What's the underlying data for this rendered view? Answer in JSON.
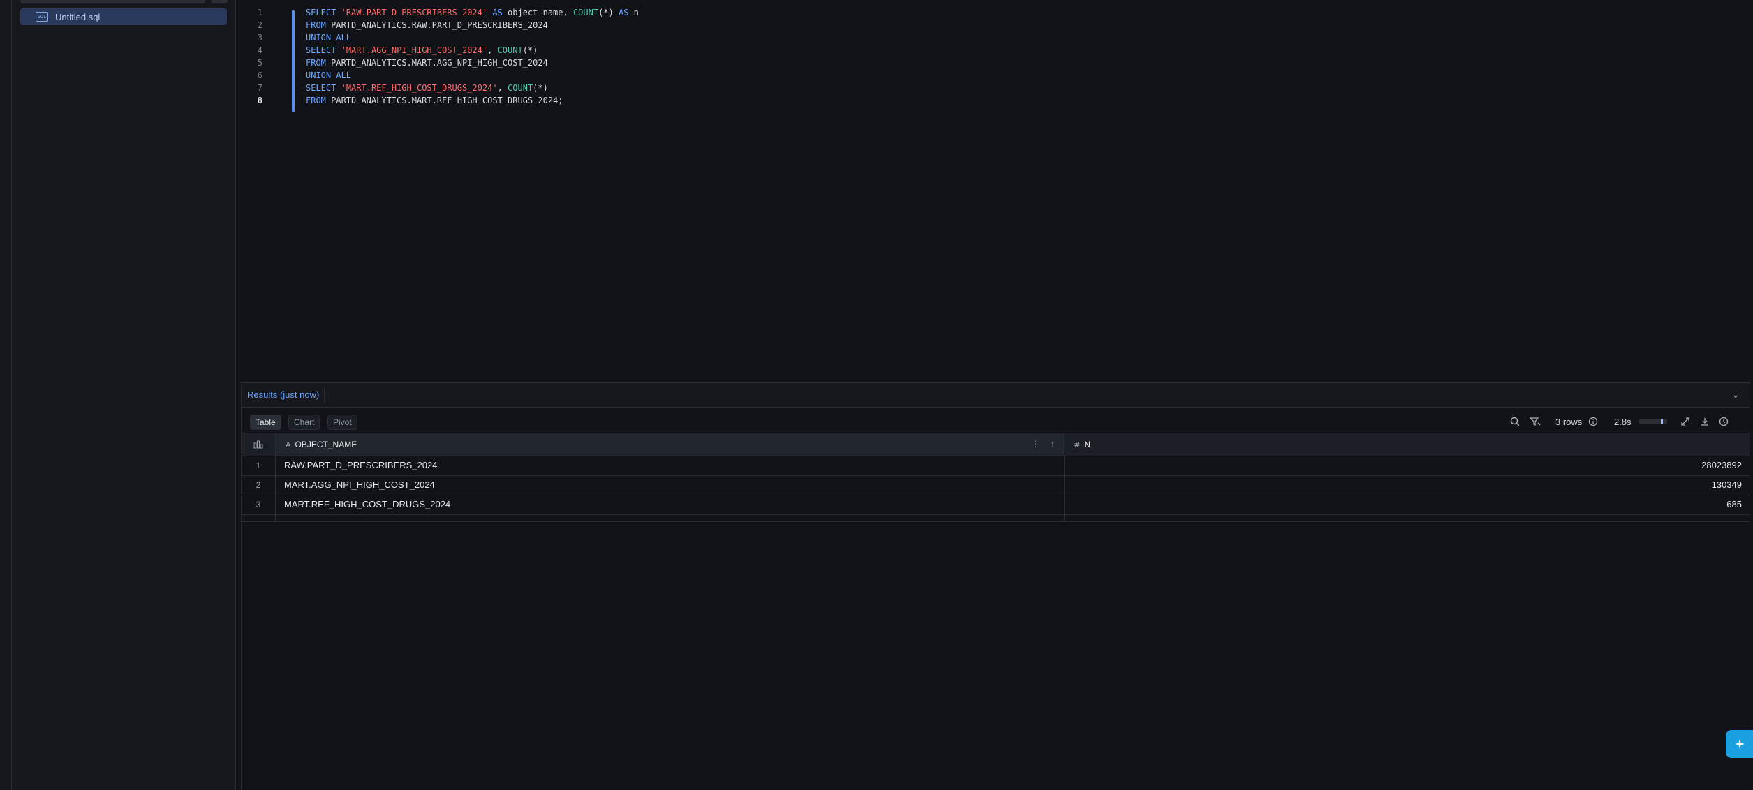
{
  "sidebar": {
    "file": {
      "label": "Untitled.sql",
      "icon": "sql-file-icon"
    }
  },
  "editor": {
    "active_line": 8,
    "lines": [
      {
        "n": "1",
        "tokens": [
          [
            "kw",
            "SELECT"
          ],
          [
            "pun",
            " "
          ],
          [
            "str",
            "'RAW.PART_D_PRESCRIBERS_2024'"
          ],
          [
            "pun",
            " "
          ],
          [
            "kw",
            "AS"
          ],
          [
            "pun",
            " object_name, "
          ],
          [
            "fn",
            "COUNT"
          ],
          [
            "pun",
            "(*) "
          ],
          [
            "kw",
            "AS"
          ],
          [
            "pun",
            " n"
          ]
        ]
      },
      {
        "n": "2",
        "tokens": [
          [
            "kw",
            "FROM"
          ],
          [
            "pun",
            " PARTD_ANALYTICS.RAW.PART_D_PRESCRIBERS_2024"
          ]
        ]
      },
      {
        "n": "3",
        "tokens": [
          [
            "kw",
            "UNION ALL"
          ]
        ]
      },
      {
        "n": "4",
        "tokens": [
          [
            "kw",
            "SELECT"
          ],
          [
            "pun",
            " "
          ],
          [
            "str",
            "'MART.AGG_NPI_HIGH_COST_2024'"
          ],
          [
            "pun",
            ", "
          ],
          [
            "fn",
            "COUNT"
          ],
          [
            "pun",
            "(*)"
          ]
        ]
      },
      {
        "n": "5",
        "tokens": [
          [
            "kw",
            "FROM"
          ],
          [
            "pun",
            " PARTD_ANALYTICS.MART.AGG_NPI_HIGH_COST_2024"
          ]
        ]
      },
      {
        "n": "6",
        "tokens": [
          [
            "kw",
            "UNION ALL"
          ]
        ]
      },
      {
        "n": "7",
        "tokens": [
          [
            "kw",
            "SELECT"
          ],
          [
            "pun",
            " "
          ],
          [
            "str",
            "'MART.REF_HIGH_COST_DRUGS_2024'"
          ],
          [
            "pun",
            ", "
          ],
          [
            "fn",
            "COUNT"
          ],
          [
            "pun",
            "(*)"
          ]
        ]
      },
      {
        "n": "8",
        "tokens": [
          [
            "kw",
            "FROM"
          ],
          [
            "pun",
            " PARTD_ANALYTICS.MART.REF_HIGH_COST_DRUGS_2024;"
          ]
        ]
      }
    ]
  },
  "results": {
    "title": "Results (just now)",
    "tabs": [
      "Table",
      "Chart",
      "Pivot"
    ],
    "active_tab": "Table",
    "row_count": "3 rows",
    "duration": "2.8s",
    "progress": 0.85,
    "columns": [
      {
        "label": "OBJECT_NAME",
        "type_icon": "text-type-icon"
      },
      {
        "label": "N",
        "type_icon": "number-type-icon"
      }
    ],
    "rows": [
      {
        "idx": "1",
        "object_name": "RAW.PART_D_PRESCRIBERS_2024",
        "n": "28023892"
      },
      {
        "idx": "2",
        "object_name": "MART.AGG_NPI_HIGH_COST_2024",
        "n": "130349"
      },
      {
        "idx": "3",
        "object_name": "MART.REF_HIGH_COST_DRUGS_2024",
        "n": "685"
      }
    ]
  },
  "colors": {
    "background": "#111318",
    "accent": "#5b8def",
    "keyword": "#6aa7ff",
    "string": "#ff6b6b",
    "function": "#4ec9b0",
    "fab": "#1a9fe0"
  }
}
